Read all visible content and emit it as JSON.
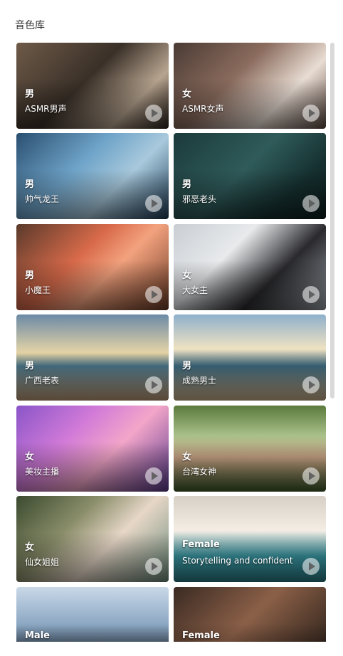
{
  "section_title": "音色库",
  "voices": [
    {
      "gender": "男",
      "name": "ASMR男声",
      "bg": "linear-gradient(135deg,#6e5a48 0%,#3a3028 45%,#b7a48f 75%,#2b211b 100%)"
    },
    {
      "gender": "女",
      "name": "ASMR女声",
      "bg": "linear-gradient(135deg,#4a3b34 0%,#8b6c5e 40%,#e8dcd3 70%,#5d4a42 100%)"
    },
    {
      "gender": "男",
      "name": "帅气龙王",
      "bg": "linear-gradient(135deg,#2a4f70 0%,#6fa4c9 40%,#a8c9dc 65%,#1e3b55 100%)"
    },
    {
      "gender": "男",
      "name": "邪恶老头",
      "bg": "linear-gradient(135deg,#1b3a3a 0%,#2f5b5a 45%,#163030 75%,#0e1e1f 100%)"
    },
    {
      "gender": "男",
      "name": "小魔王",
      "bg": "linear-gradient(135deg,#5a3a2b 0%,#d86a4a 40%,#f3a27e 60%,#6b3b25 100%)"
    },
    {
      "gender": "女",
      "name": "大女主",
      "bg": "linear-gradient(135deg,#c9ced3 0%,#e8eaec 35%,#2a2a2e 65%,#9aa0a6 100%)"
    },
    {
      "gender": "男",
      "name": "广西老表",
      "bg": "linear-gradient(180deg,#6b8aa6 0%,#e7d5a6 45%,#4f7d93 60%,#c2a07a 100%)"
    },
    {
      "gender": "男",
      "name": "成熟男士",
      "bg": "linear-gradient(180deg,#8fb0cc 0%,#f0e2c2 40%,#3f6f86 60%,#d1b48c 100%)"
    },
    {
      "gender": "女",
      "name": "美妆主播",
      "bg": "linear-gradient(135deg,#8a55c8 0%,#d17ad8 35%,#f3a6c9 60%,#5a3a8c 100%)"
    },
    {
      "gender": "女",
      "name": "台湾女神",
      "bg": "linear-gradient(180deg,#5b7a3c 0%,#a9c08a 35%,#caa486 60%,#3d5a2a 100%)"
    },
    {
      "gender": "女",
      "name": "仙女姐姐",
      "bg": "linear-gradient(135deg,#3b4a2f 0%,#8a8e6a 35%,#e7d7c7 60%,#6a8a7a 100%)"
    },
    {
      "gender": "Female",
      "name": "Storytelling and confident",
      "bg": "linear-gradient(180deg,#d7d0c6 0%,#f4ede4 40%,#3b9aa6 70%,#2a7c86 100%)"
    },
    {
      "gender": "Male",
      "name": "",
      "bg": "linear-gradient(180deg,#c9d8e8 0%,#8aa6c2 45%,#3b4a5a 75%,#23303c 100%)"
    },
    {
      "gender": "Female",
      "name": "",
      "bg": "linear-gradient(135deg,#3a2a22 0%,#8b6048 45%,#1c1612 100%)"
    }
  ]
}
